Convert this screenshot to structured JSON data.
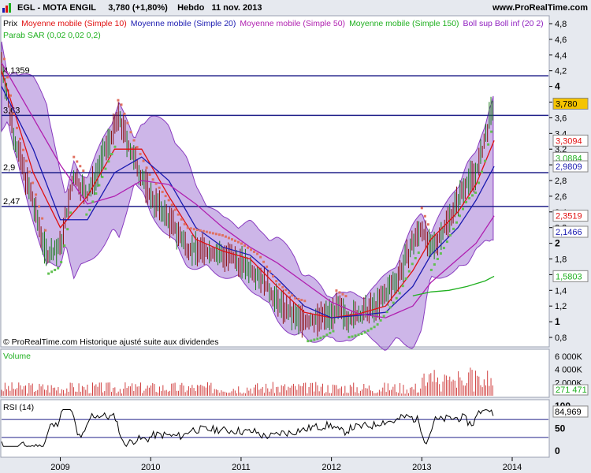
{
  "header": {
    "title": "EGL - MOTA ENGIL",
    "price": "3,780 (+1,80%)",
    "period": "Hebdo",
    "date": "11 nov. 2013",
    "site": "www.ProRealTime.com"
  },
  "legend": [
    {
      "text": "Prix",
      "color": "#000000"
    },
    {
      "text": "Moyenne mobile (Simple 10)",
      "color": "#e01010"
    },
    {
      "text": "Moyenne mobile (Simple 20)",
      "color": "#1a1ab0"
    },
    {
      "text": "Moyenne mobile (Simple 50)",
      "color": "#b020b0"
    },
    {
      "text": "Moyenne mobile (Simple 150)",
      "color": "#20b020"
    },
    {
      "text": "Boll sup Boll inf (20 2)",
      "color": "#9020c0"
    }
  ],
  "legend2": {
    "text": "Parab SAR (0,02 0,02 0,2)",
    "color": "#20b020"
  },
  "copyright": "© ProRealTime.com  Historique ajusté suite aux dividendes",
  "hlines": [
    {
      "label": "4,1359",
      "value": 4.1359
    },
    {
      "label": "3,63",
      "value": 3.63
    },
    {
      "label": "2,9",
      "value": 2.9
    },
    {
      "label": "2,47",
      "value": 2.47
    }
  ],
  "price_axis": {
    "ticks": [
      "4,8",
      "4,6",
      "4,4",
      "4,2",
      "4",
      "3,8",
      "3,6",
      "3,4",
      "3,2",
      "3",
      "2,8",
      "2,6",
      "2,4",
      "2,2",
      "2",
      "1,8",
      "1,6",
      "1,4",
      "1,2",
      "1",
      "0,8"
    ],
    "values": [
      4.8,
      4.6,
      4.4,
      4.2,
      4.0,
      3.8,
      3.6,
      3.4,
      3.2,
      3.0,
      2.8,
      2.6,
      2.4,
      2.2,
      2.0,
      1.8,
      1.6,
      1.4,
      1.2,
      1.0,
      0.8
    ],
    "bold": [
      "4",
      "3",
      "2",
      "1"
    ]
  },
  "price_tags": [
    {
      "label": "3,780",
      "value": 3.78,
      "fill": "#f5c400",
      "text": "#000000"
    },
    {
      "label": "3,3094",
      "value": 3.3094,
      "fill": "#ffffff",
      "text": "#e01010"
    },
    {
      "label": "3,0884",
      "value": 3.0884,
      "fill": "#ffffff",
      "text": "#20b020"
    },
    {
      "label": "2,9809",
      "value": 2.9809,
      "fill": "#ffffff",
      "text": "#1a1ab0"
    },
    {
      "label": "2,3519",
      "value": 2.3519,
      "fill": "#ffffff",
      "text": "#e01010"
    },
    {
      "label": "2,1466",
      "value": 2.1466,
      "fill": "#ffffff",
      "text": "#1a1ab0"
    },
    {
      "label": "1,5803",
      "value": 1.5803,
      "fill": "#ffffff",
      "text": "#20b020"
    }
  ],
  "volume": {
    "label": "Volume",
    "ticks": [
      "6 000K",
      "4 000K",
      "2 000K"
    ],
    "values": [
      6000,
      4000,
      2000
    ],
    "tag": "271 471"
  },
  "rsi": {
    "label": "RSI (14)",
    "ticks": [
      "100",
      "50",
      "0"
    ],
    "values": [
      100,
      50,
      0
    ],
    "levels": [
      70,
      30
    ],
    "tag": "84,969"
  },
  "x_axis": [
    "2009",
    "2010",
    "2011",
    "2012",
    "2013",
    "2014"
  ],
  "chart_data": {
    "type": "line",
    "title": "EGL - MOTA ENGIL",
    "x_ticks": [
      "2009",
      "2010",
      "2011",
      "2012",
      "2013",
      "2014"
    ],
    "ylim": [
      0.7,
      4.9
    ],
    "grid": false,
    "series": [
      {
        "name": "Prix",
        "x": [
          2008.35,
          2008.5,
          2008.7,
          2008.85,
          2009.0,
          2009.15,
          2009.3,
          2009.5,
          2009.65,
          2009.8,
          2010.0,
          2010.2,
          2010.4,
          2010.6,
          2010.8,
          2011.0,
          2011.2,
          2011.4,
          2011.6,
          2011.75,
          2011.9,
          2012.05,
          2012.2,
          2012.35,
          2012.5,
          2012.6,
          2012.75,
          2012.9,
          2013.0,
          2013.1,
          2013.25,
          2013.4,
          2013.5,
          2013.6,
          2013.7,
          2013.75,
          2013.8
        ],
        "y": [
          4.3,
          3.3,
          2.5,
          1.85,
          1.95,
          2.85,
          2.6,
          3.2,
          3.6,
          3.1,
          2.6,
          2.3,
          1.95,
          1.9,
          1.85,
          1.75,
          1.6,
          1.25,
          1.05,
          1.0,
          1.05,
          1.15,
          1.05,
          1.1,
          1.2,
          1.35,
          1.6,
          2.0,
          2.2,
          1.9,
          2.2,
          2.55,
          2.8,
          2.9,
          3.3,
          3.6,
          3.78
        ]
      },
      {
        "name": "Moyenne mobile (Simple 10)",
        "x": [
          2008.35,
          2008.7,
          2009.0,
          2009.3,
          2009.6,
          2009.9,
          2010.2,
          2010.5,
          2010.8,
          2011.1,
          2011.4,
          2011.7,
          2012.0,
          2012.3,
          2012.6,
          2012.9,
          2013.1,
          2013.4,
          2013.6,
          2013.8
        ],
        "y": [
          4.2,
          2.9,
          2.2,
          2.6,
          3.2,
          3.2,
          2.6,
          2.05,
          1.9,
          1.8,
          1.45,
          1.12,
          1.05,
          1.1,
          1.2,
          1.65,
          2.05,
          2.4,
          2.75,
          3.31
        ]
      },
      {
        "name": "Moyenne mobile (Simple 20)",
        "x": [
          2008.35,
          2008.7,
          2009.0,
          2009.3,
          2009.6,
          2009.9,
          2010.2,
          2010.5,
          2010.8,
          2011.1,
          2011.4,
          2011.7,
          2012.0,
          2012.3,
          2012.6,
          2012.9,
          2013.1,
          2013.4,
          2013.6,
          2013.8
        ],
        "y": [
          4.0,
          3.2,
          2.3,
          2.3,
          2.9,
          3.1,
          2.8,
          2.2,
          1.95,
          1.85,
          1.55,
          1.2,
          1.05,
          1.08,
          1.12,
          1.45,
          1.85,
          2.2,
          2.55,
          2.98
        ]
      },
      {
        "name": "Moyenne mobile (Simple 50)",
        "x": [
          2008.35,
          2008.7,
          2009.0,
          2009.3,
          2009.6,
          2009.9,
          2010.2,
          2010.5,
          2010.8,
          2011.1,
          2011.4,
          2011.7,
          2012.0,
          2012.3,
          2012.6,
          2012.9,
          2013.1,
          2013.4,
          2013.6,
          2013.8
        ],
        "y": [
          4.3,
          3.6,
          3.0,
          2.5,
          2.6,
          2.8,
          2.75,
          2.5,
          2.2,
          1.95,
          1.75,
          1.5,
          1.25,
          1.1,
          1.05,
          1.2,
          1.5,
          1.8,
          2.0,
          2.35
        ]
      },
      {
        "name": "Moyenne mobile (Simple 150)",
        "x": [
          2012.9,
          2013.1,
          2013.3,
          2013.5,
          2013.7,
          2013.8
        ],
        "y": [
          1.33,
          1.38,
          1.4,
          1.45,
          1.52,
          1.58
        ]
      }
    ]
  }
}
